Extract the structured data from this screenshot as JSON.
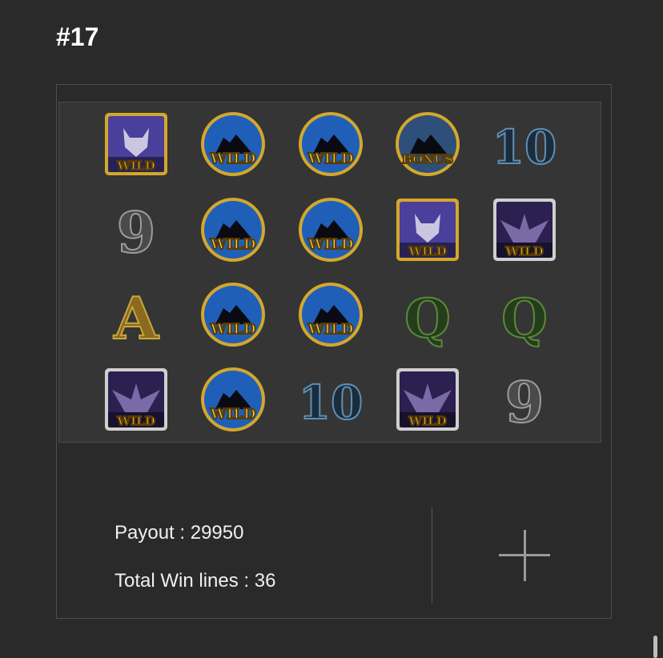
{
  "title": "#17",
  "reels": {
    "rows": [
      [
        {
          "symbol": "wolf-wild",
          "label": "WILD"
        },
        {
          "symbol": "wild-coin",
          "label": "WILD"
        },
        {
          "symbol": "wild-coin",
          "label": "WILD"
        },
        {
          "symbol": "bonus-coin",
          "label": "BONUS"
        },
        {
          "symbol": "ten",
          "label": "10"
        }
      ],
      [
        {
          "symbol": "nine",
          "label": "9"
        },
        {
          "symbol": "wild-coin",
          "label": "WILD"
        },
        {
          "symbol": "wild-coin",
          "label": "WILD"
        },
        {
          "symbol": "wolf-wild",
          "label": "WILD"
        },
        {
          "symbol": "owl-wild",
          "label": "WILD"
        }
      ],
      [
        {
          "symbol": "ace",
          "label": "A"
        },
        {
          "symbol": "wild-coin",
          "label": "WILD"
        },
        {
          "symbol": "wild-coin",
          "label": "WILD"
        },
        {
          "symbol": "queen",
          "label": "Q"
        },
        {
          "symbol": "queen",
          "label": "Q"
        }
      ],
      [
        {
          "symbol": "owl-wild",
          "label": "WILD"
        },
        {
          "symbol": "wild-coin",
          "label": "WILD"
        },
        {
          "symbol": "ten",
          "label": "10"
        },
        {
          "symbol": "owl-wild",
          "label": "WILD"
        },
        {
          "symbol": "nine",
          "label": "9"
        }
      ]
    ]
  },
  "summary": {
    "payout": "Payout : 29950",
    "win_lines": "Total Win lines : 36"
  },
  "colors": {
    "gold": "#d4a72c",
    "wild_blue": "#1f5fb8",
    "ten_blue": "#5e8fb4",
    "nine_silver": "#9c9c9c",
    "ace_gold": "#c9a63a",
    "queen_green": "#5a8a3a"
  }
}
